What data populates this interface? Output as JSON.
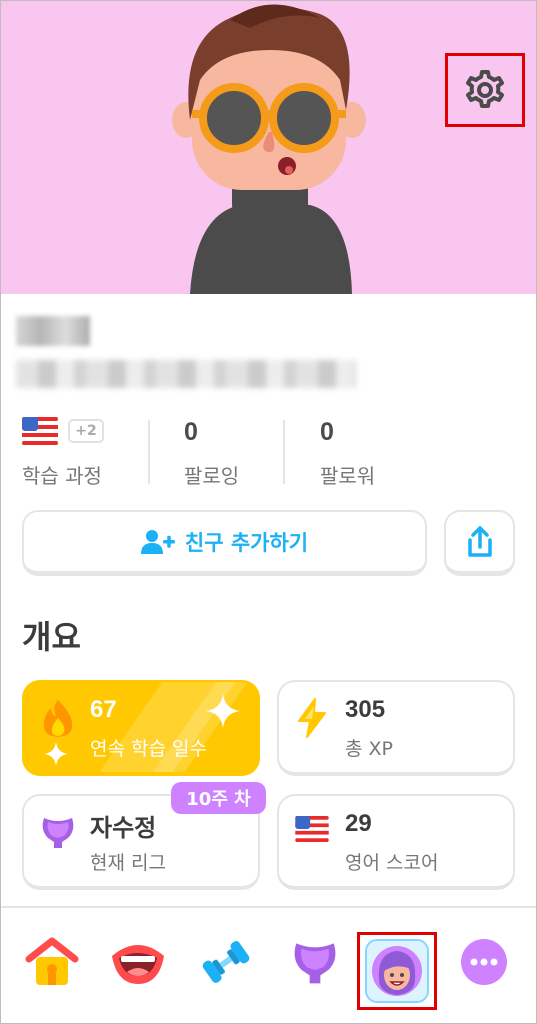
{
  "profile": {
    "stats": {
      "courses_label": "학습 과정",
      "courses_extra": "+2",
      "following_value": "0",
      "following_label": "팔로잉",
      "followers_value": "0",
      "followers_label": "팔로워"
    },
    "actions": {
      "add_friend_label": "친구 추가하기"
    }
  },
  "overview": {
    "title": "개요",
    "streak": {
      "value": "67",
      "label": "연속 학습 일수"
    },
    "xp": {
      "value": "305",
      "label": "총 XP"
    },
    "league": {
      "name": "자수정",
      "label": "현재 리그",
      "badge": "10주 차"
    },
    "score": {
      "value": "29",
      "label": "영어 스코어"
    }
  },
  "nav": {
    "items": [
      "home-icon",
      "speaking-icon",
      "practice-icon",
      "leagues-icon",
      "profile-icon",
      "more-icon"
    ],
    "active": "profile-icon"
  },
  "colors": {
    "header_bg": "#f9c6f0",
    "accent_blue": "#1cb0f6",
    "streak_yellow": "#ffc800",
    "league_purple": "#ce82ff",
    "highlight_red": "#e00000"
  }
}
